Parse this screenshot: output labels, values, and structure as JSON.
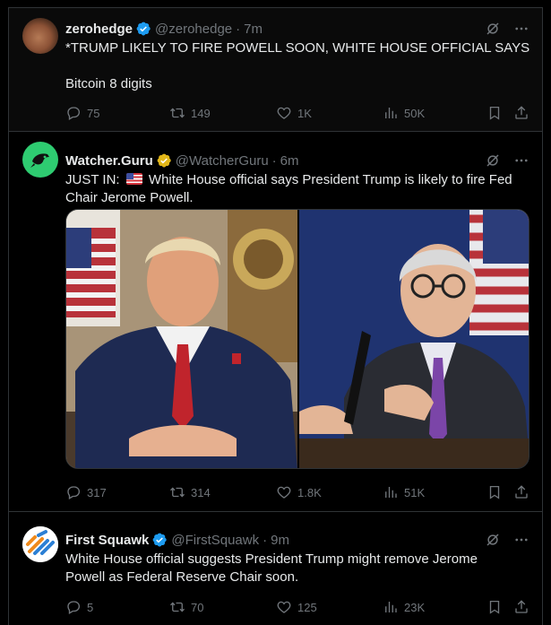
{
  "colors": {
    "background": "#000000",
    "text": "#e7e9ea",
    "muted": "#71767b",
    "border": "#2f3336",
    "verified_blue": "#1d9bf0",
    "verified_gold": "#e2b719"
  },
  "tweets": [
    {
      "name": "zerohedge",
      "handle": "@zerohedge",
      "time": "7m",
      "verified": "blue",
      "text_lines": [
        "*TRUMP LIKELY TO FIRE POWELL SOON, WHITE HOUSE OFFICIAL SAYS",
        "",
        "Bitcoin 8 digits"
      ],
      "line1": "*TRUMP LIKELY TO FIRE POWELL SOON, WHITE HOUSE OFFICIAL SAYS",
      "line2": "Bitcoin 8 digits",
      "replies": "75",
      "retweets": "149",
      "likes": "1K",
      "views": "50K"
    },
    {
      "name": "Watcher.Guru",
      "handle": "@WatcherGuru",
      "time": "6m",
      "verified": "gold",
      "prefix": "JUST IN:",
      "line1": "White House official says President Trump is likely to fire Fed",
      "line2": "Chair Jerome Powell.",
      "replies": "317",
      "retweets": "314",
      "likes": "1.8K",
      "views": "51K"
    },
    {
      "name": "First Squawk",
      "handle": "@FirstSquawk",
      "time": "9m",
      "verified": "blue",
      "line1": "White House official suggests President Trump might remove Jerome",
      "line2": "Powell as Federal Reserve Chair soon.",
      "replies": "5",
      "retweets": "70",
      "likes": "125",
      "views": "23K"
    }
  ],
  "separator": "·",
  "icons": [
    "grok-icon",
    "more-icon",
    "reply-icon",
    "retweet-icon",
    "like-icon",
    "views-icon",
    "bookmark-icon",
    "share-icon",
    "verified-badge-icon",
    "us-flag-icon"
  ]
}
